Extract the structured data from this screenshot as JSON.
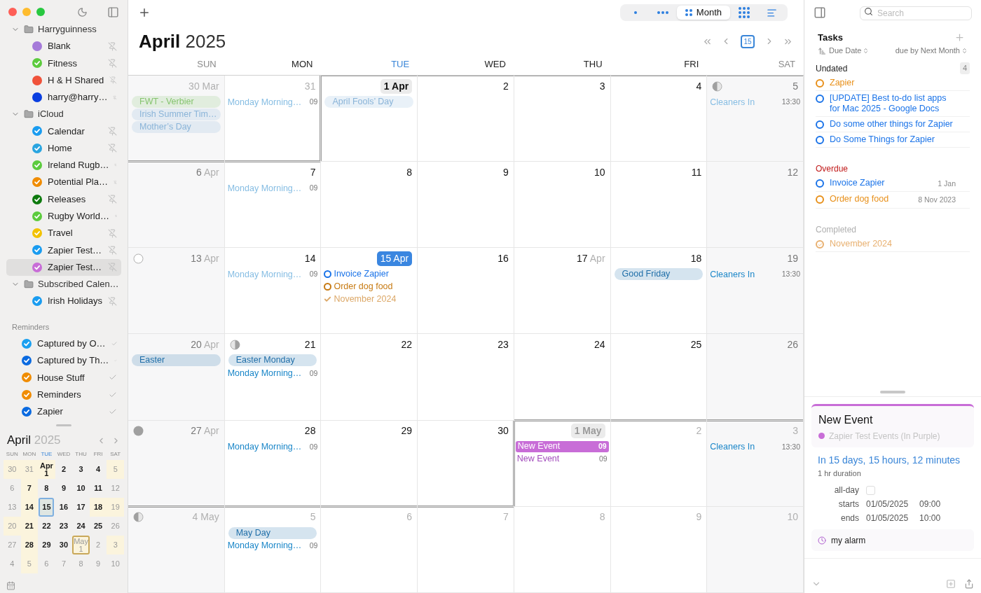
{
  "sidebar": {
    "groups": [
      {
        "name": "Harryguinness",
        "expanded": true,
        "items": [
          {
            "name": "Blank",
            "color": "#a57ad9",
            "checked": false,
            "selected": false
          },
          {
            "name": "Fitness",
            "color": "#5ccb3d",
            "checked": true,
            "selected": false
          },
          {
            "name": "H & H Shared",
            "color": "#f0523a",
            "checked": false,
            "selected": false
          },
          {
            "name": "harry@harry…",
            "color": "#0a3ee0",
            "checked": false,
            "selected": false
          }
        ]
      },
      {
        "name": "iCloud",
        "expanded": true,
        "items": [
          {
            "name": "Calendar",
            "color": "#1a9cf0",
            "checked": true,
            "selected": false
          },
          {
            "name": "Home",
            "color": "#2aa5e0",
            "checked": true,
            "selected": false
          },
          {
            "name": "Ireland Rugb…",
            "color": "#5ccb3d",
            "checked": true,
            "selected": false
          },
          {
            "name": "Potential Pla…",
            "color": "#f08c00",
            "checked": true,
            "selected": false
          },
          {
            "name": "Releases",
            "color": "#0e7a0e",
            "checked": true,
            "selected": false
          },
          {
            "name": "Rugby World…",
            "color": "#5ccb3d",
            "checked": true,
            "selected": false
          },
          {
            "name": "Travel",
            "color": "#f2c200",
            "checked": true,
            "selected": false
          },
          {
            "name": "Zapier Test…",
            "color": "#1a9cf0",
            "checked": true,
            "selected": false
          },
          {
            "name": "Zapier Test…",
            "color": "#c86dd7",
            "checked": true,
            "selected": true
          }
        ]
      },
      {
        "name": "Subscribed Calen…",
        "expanded": true,
        "items": [
          {
            "name": "Irish Holidays",
            "color": "#1a9cf0",
            "checked": true,
            "selected": false
          }
        ]
      }
    ],
    "reminders": {
      "title": "Reminders",
      "items": [
        {
          "name": "Captured by O…",
          "color": "#1aa0f0",
          "checked": true
        },
        {
          "name": "Captured by Th…",
          "color": "#0a6ae0",
          "checked": true
        },
        {
          "name": "House Stuff",
          "color": "#f08c00",
          "checked": true
        },
        {
          "name": "Reminders",
          "color": "#f08c00",
          "checked": true
        },
        {
          "name": "Zapier",
          "color": "#0a6ae0",
          "checked": true
        }
      ]
    },
    "mini_calendar": {
      "month": "April",
      "year": "2025",
      "weekdays": [
        {
          "label": "SUN",
          "selected": false
        },
        {
          "label": "MON",
          "selected": false
        },
        {
          "label": "TUE",
          "selected": true
        },
        {
          "label": "WED",
          "selected": false
        },
        {
          "label": "THU",
          "selected": false
        },
        {
          "label": "FRI",
          "selected": false
        },
        {
          "label": "SAT",
          "selected": false
        }
      ],
      "days": [
        {
          "day": "30",
          "dim": true,
          "marked": true,
          "selected": false,
          "outlined": false
        },
        {
          "day": "31",
          "dim": true,
          "marked": true,
          "selected": false,
          "outlined": false
        },
        {
          "month": "Apr",
          "day": "1",
          "dim": false,
          "marked": true,
          "selected": false,
          "outlined": false
        },
        {
          "day": "2",
          "dim": false,
          "marked": false,
          "selected": false,
          "outlined": false
        },
        {
          "day": "3",
          "dim": false,
          "marked": false,
          "selected": false,
          "outlined": false
        },
        {
          "day": "4",
          "dim": false,
          "marked": false,
          "selected": false,
          "outlined": false
        },
        {
          "day": "5",
          "dim": true,
          "marked": true,
          "selected": false,
          "outlined": false
        },
        {
          "day": "6",
          "dim": true,
          "marked": false,
          "selected": false,
          "outlined": false
        },
        {
          "day": "7",
          "dim": false,
          "marked": true,
          "selected": false,
          "outlined": false
        },
        {
          "day": "8",
          "dim": false,
          "marked": false,
          "selected": false,
          "outlined": false
        },
        {
          "day": "9",
          "dim": false,
          "marked": false,
          "selected": false,
          "outlined": false
        },
        {
          "day": "10",
          "dim": false,
          "marked": false,
          "selected": false,
          "outlined": false
        },
        {
          "day": "11",
          "dim": false,
          "marked": false,
          "selected": false,
          "outlined": false
        },
        {
          "day": "12",
          "dim": true,
          "marked": false,
          "selected": false,
          "outlined": false
        },
        {
          "day": "13",
          "dim": true,
          "marked": false,
          "selected": false,
          "outlined": false
        },
        {
          "day": "14",
          "dim": false,
          "marked": true,
          "selected": false,
          "outlined": false
        },
        {
          "day": "15",
          "dim": false,
          "marked": false,
          "selected": true,
          "outlined": false
        },
        {
          "day": "16",
          "dim": false,
          "marked": false,
          "selected": false,
          "outlined": false
        },
        {
          "day": "17",
          "dim": false,
          "marked": false,
          "selected": false,
          "outlined": false
        },
        {
          "day": "18",
          "dim": false,
          "marked": true,
          "selected": false,
          "outlined": false
        },
        {
          "day": "19",
          "dim": true,
          "marked": true,
          "selected": false,
          "outlined": false
        },
        {
          "day": "20",
          "dim": true,
          "marked": true,
          "selected": false,
          "outlined": false
        },
        {
          "day": "21",
          "dim": false,
          "marked": true,
          "selected": false,
          "outlined": false
        },
        {
          "day": "22",
          "dim": false,
          "marked": false,
          "selected": false,
          "outlined": false
        },
        {
          "day": "23",
          "dim": false,
          "marked": false,
          "selected": false,
          "outlined": false
        },
        {
          "day": "24",
          "dim": false,
          "marked": false,
          "selected": false,
          "outlined": false
        },
        {
          "day": "25",
          "dim": false,
          "marked": false,
          "selected": false,
          "outlined": false
        },
        {
          "day": "26",
          "dim": true,
          "marked": false,
          "selected": false,
          "outlined": false
        },
        {
          "day": "27",
          "dim": true,
          "marked": false,
          "selected": false,
          "outlined": false
        },
        {
          "day": "28",
          "dim": false,
          "marked": true,
          "selected": false,
          "outlined": false
        },
        {
          "day": "29",
          "dim": false,
          "marked": false,
          "selected": false,
          "outlined": false
        },
        {
          "day": "30",
          "dim": false,
          "marked": false,
          "selected": false,
          "outlined": false
        },
        {
          "month": "May",
          "day": "1",
          "dim": true,
          "marked": true,
          "selected": false,
          "outlined": true
        },
        {
          "day": "2",
          "dim": true,
          "marked": false,
          "selected": false,
          "outlined": false
        },
        {
          "day": "3",
          "dim": true,
          "marked": true,
          "selected": false,
          "outlined": false
        },
        {
          "day": "4",
          "dim": true,
          "marked": false,
          "selected": false,
          "outlined": false
        },
        {
          "day": "5",
          "dim": true,
          "marked": true,
          "selected": false,
          "outlined": false
        },
        {
          "day": "6",
          "dim": true,
          "marked": false,
          "selected": false,
          "outlined": false
        },
        {
          "day": "7",
          "dim": true,
          "marked": false,
          "selected": false,
          "outlined": false
        },
        {
          "day": "8",
          "dim": true,
          "marked": false,
          "selected": false,
          "outlined": false
        },
        {
          "day": "9",
          "dim": true,
          "marked": false,
          "selected": false,
          "outlined": false
        },
        {
          "day": "10",
          "dim": true,
          "marked": false,
          "selected": false,
          "outlined": false
        }
      ]
    }
  },
  "toolbar": {
    "views": [
      {
        "kind": "day",
        "selected": false
      },
      {
        "kind": "week",
        "selected": false
      },
      {
        "kind": "month",
        "label": "Month",
        "selected": true
      },
      {
        "kind": "year",
        "selected": false
      },
      {
        "kind": "list",
        "selected": false
      }
    ],
    "today": "15"
  },
  "calendar": {
    "month": "April",
    "year": "2025",
    "weekdays": [
      {
        "label": "SUN",
        "selected": false
      },
      {
        "label": "MON",
        "selected": false
      },
      {
        "label": "TUE",
        "selected": true
      },
      {
        "label": "WED",
        "selected": false
      },
      {
        "label": "THU",
        "selected": false
      },
      {
        "label": "FRI",
        "selected": false
      },
      {
        "label": "SAT",
        "selected": false
      }
    ],
    "weeks": [
      [
        {
          "kind": "day",
          "day": "30",
          "month": "Mar",
          "in_month": false,
          "events": [
            {
              "kind": "allday",
              "title": "FWT - Verbier",
              "color": "#86c46f"
            },
            {
              "kind": "allday",
              "title": "Irish Summer Tim…",
              "color": "#8ab4d8"
            },
            {
              "kind": "allday",
              "title": "Mother’s Day",
              "color": "#8ab4d8"
            }
          ]
        },
        {
          "kind": "day",
          "day": "31",
          "in_month": false,
          "events": [
            {
              "kind": "timed",
              "title": "Monday Morning…",
              "time": "09",
              "color": "#86bde3"
            }
          ]
        },
        {
          "kind": "month_start",
          "day": "1",
          "month": "Apr",
          "in_month": true,
          "events": [
            {
              "kind": "allday",
              "title": "April Fools’ Day",
              "color": "#8ab4d8"
            }
          ]
        },
        {
          "kind": "day",
          "day": "2",
          "in_month": true
        },
        {
          "kind": "day",
          "day": "3",
          "in_month": true
        },
        {
          "kind": "day",
          "day": "4",
          "in_month": true
        },
        {
          "kind": "first_quarter",
          "day": "5",
          "in_month": true,
          "events": [
            {
              "kind": "timed",
              "title": "Cleaners In",
              "time": "13:30",
              "color": "#86bde3"
            }
          ]
        }
      ],
      [
        {
          "kind": "day",
          "day": "6",
          "month": "Apr",
          "in_month": true
        },
        {
          "kind": "day",
          "day": "7",
          "in_month": true,
          "events": [
            {
              "kind": "timed",
              "title": "Monday Morning…",
              "time": "09",
              "color": "#86bde3"
            }
          ]
        },
        {
          "kind": "day",
          "day": "8",
          "in_month": true
        },
        {
          "kind": "day",
          "day": "9",
          "in_month": true
        },
        {
          "kind": "day",
          "day": "10",
          "in_month": true
        },
        {
          "kind": "day",
          "day": "11",
          "in_month": true
        },
        {
          "kind": "day",
          "day": "12",
          "in_month": true
        }
      ],
      [
        {
          "kind": "full_moon",
          "day": "13",
          "month": "Apr",
          "in_month": true
        },
        {
          "kind": "day",
          "day": "14",
          "in_month": true,
          "events": [
            {
              "kind": "timed",
              "title": "Monday Morning…",
              "time": "09",
              "color": "#86bde3"
            }
          ]
        },
        {
          "kind": "today",
          "day": "15",
          "month": "Apr",
          "in_month": true,
          "events": [
            {
              "kind": "task",
              "title": "Invoice Zapier",
              "color": "#1a73e8"
            },
            {
              "kind": "task",
              "title": "Order dog food",
              "color": "#c77a12"
            },
            {
              "kind": "done",
              "title": "November 2024",
              "color": "#dca868"
            }
          ]
        },
        {
          "kind": "day",
          "day": "16",
          "in_month": true
        },
        {
          "kind": "day",
          "day": "17",
          "month": "Apr",
          "in_month": true
        },
        {
          "kind": "day",
          "day": "18",
          "in_month": true,
          "events": [
            {
              "kind": "allday",
              "title": "Good Friday",
              "color": "#1f6ea8"
            }
          ]
        },
        {
          "kind": "day",
          "day": "19",
          "in_month": true,
          "events": [
            {
              "kind": "timed",
              "title": "Cleaners In",
              "time": "13:30",
              "color": "#1a86c8"
            }
          ]
        }
      ],
      [
        {
          "kind": "day",
          "day": "20",
          "month": "Apr",
          "in_month": true,
          "events": [
            {
              "kind": "allday",
              "title": "Easter",
              "color": "#1f6ea8"
            }
          ]
        },
        {
          "kind": "last_quarter",
          "day": "21",
          "in_month": true,
          "events": [
            {
              "kind": "allday",
              "title": "Easter Monday",
              "color": "#1f6ea8"
            },
            {
              "kind": "timed",
              "title": "Monday Morning…",
              "time": "09",
              "color": "#1a86c8"
            }
          ]
        },
        {
          "kind": "day",
          "day": "22",
          "in_month": true
        },
        {
          "kind": "day",
          "day": "23",
          "in_month": true
        },
        {
          "kind": "day",
          "day": "24",
          "in_month": true
        },
        {
          "kind": "day",
          "day": "25",
          "in_month": true
        },
        {
          "kind": "day",
          "day": "26",
          "in_month": true
        }
      ],
      [
        {
          "kind": "new_moon",
          "day": "27",
          "month": "Apr",
          "in_month": true
        },
        {
          "kind": "day",
          "day": "28",
          "in_month": true,
          "events": [
            {
              "kind": "timed",
              "title": "Monday Morning…",
              "time": "09",
              "color": "#1a86c8"
            }
          ]
        },
        {
          "kind": "day",
          "day": "29",
          "in_month": true
        },
        {
          "kind": "day",
          "day": "30",
          "in_month": true
        },
        {
          "kind": "month_start",
          "day": "1",
          "month": "May",
          "in_month": false,
          "events": [
            {
              "kind": "block",
              "title": "New Event",
              "time": "09",
              "color": "#c86dd7"
            },
            {
              "kind": "timed",
              "title": "New Event",
              "time": "09",
              "color": "#a24cbc"
            }
          ]
        },
        {
          "kind": "day",
          "day": "2",
          "in_month": false
        },
        {
          "kind": "day",
          "day": "3",
          "in_month": false,
          "events": [
            {
              "kind": "timed",
              "title": "Cleaners In",
              "time": "13:30",
              "color": "#1a86c8"
            }
          ]
        }
      ],
      [
        {
          "kind": "first_quarter",
          "day": "4",
          "month": "May",
          "in_month": false
        },
        {
          "kind": "day",
          "day": "5",
          "in_month": false,
          "events": [
            {
              "kind": "allday",
              "title": "May Day",
              "color": "#1f6ea8"
            },
            {
              "kind": "timed",
              "title": "Monday Morning…",
              "time": "09",
              "color": "#1a86c8"
            }
          ]
        },
        {
          "kind": "day",
          "day": "6",
          "in_month": false
        },
        {
          "kind": "day",
          "day": "7",
          "in_month": false
        },
        {
          "kind": "day",
          "day": "8",
          "in_month": false
        },
        {
          "kind": "day",
          "day": "9",
          "in_month": false
        },
        {
          "kind": "day",
          "day": "10",
          "in_month": false
        }
      ]
    ]
  },
  "tasks": {
    "search": {
      "placeholder": "Search"
    },
    "title": "Tasks",
    "sort": "Due Date",
    "filter": "due by Next Month",
    "sections": [
      {
        "kind": "undated",
        "title": "Undated",
        "count": "4",
        "items": [
          {
            "title": "Zapier",
            "color": "#e8901a",
            "done": false
          },
          {
            "title": "[UPDATE] Best to-do list apps for Mac 2025 - Google Docs",
            "color": "#1a73e8",
            "done": false
          },
          {
            "title": "Do some other things for Zapier",
            "color": "#1a73e8",
            "done": false
          },
          {
            "title": "Do Some Things for Zapier",
            "color": "#1a73e8",
            "done": false
          }
        ]
      },
      {
        "kind": "overdue",
        "title": "Overdue",
        "items": [
          {
            "title": "Invoice Zapier",
            "date": "1 Jan",
            "color": "#1a73e8",
            "done": false
          },
          {
            "title": "Order dog food",
            "date": "8 Nov 2023",
            "color": "#e8901a",
            "done": false
          }
        ]
      },
      {
        "kind": "completed",
        "title": "Completed",
        "items": [
          {
            "title": "November 2024",
            "color": "#e8b070",
            "done": true
          }
        ]
      }
    ]
  },
  "event_detail": {
    "title": "New Event",
    "calendar": "Zapier Test Events (In Purple)",
    "color": "#c86dd7",
    "relative": "In 15 days, 15 hours, 12 minutes",
    "duration": "1 hr duration",
    "fields": [
      {
        "kind": "checkbox",
        "label": "all-day",
        "checked": false
      },
      {
        "kind": "datetime",
        "label": "starts",
        "date": "01/05/2025",
        "time": "09:00"
      },
      {
        "kind": "datetime",
        "label": "ends",
        "date": "01/05/2025",
        "time": "10:00"
      }
    ],
    "alarm": "my alarm"
  }
}
